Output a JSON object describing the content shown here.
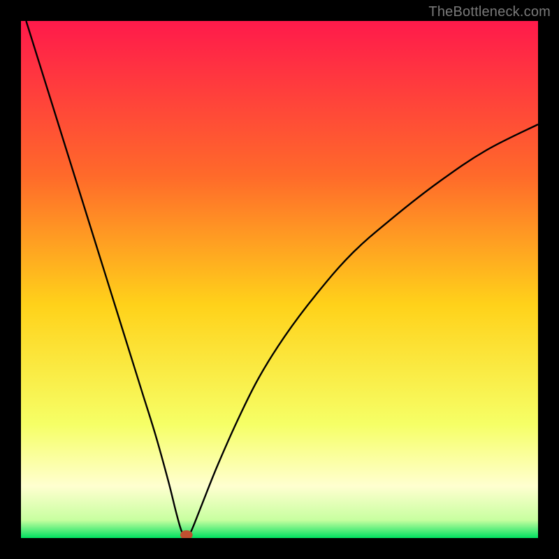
{
  "watermark": "TheBottleneck.com",
  "chart_data": {
    "type": "line",
    "title": "",
    "xlabel": "",
    "ylabel": "",
    "xlim": [
      0,
      100
    ],
    "ylim": [
      0,
      100
    ],
    "grid": false,
    "legend": false,
    "gradient_stops": [
      {
        "offset": 0.0,
        "color": "#ff1a4b"
      },
      {
        "offset": 0.3,
        "color": "#ff6a2a"
      },
      {
        "offset": 0.55,
        "color": "#ffd21a"
      },
      {
        "offset": 0.78,
        "color": "#f6ff66"
      },
      {
        "offset": 0.9,
        "color": "#ffffd0"
      },
      {
        "offset": 0.965,
        "color": "#c8ffa0"
      },
      {
        "offset": 1.0,
        "color": "#00e060"
      }
    ],
    "series": [
      {
        "name": "curve",
        "color": "#000000",
        "x": [
          1,
          3.5,
          6,
          8.5,
          11,
          13.5,
          16,
          18.5,
          21,
          23.5,
          26,
          28.5,
          30,
          31,
          31.7,
          32.3,
          33,
          35,
          38,
          42,
          46,
          51,
          57,
          64,
          72,
          81,
          90,
          100
        ],
        "y": [
          100,
          92,
          84,
          76,
          68,
          60,
          52,
          44,
          36,
          28,
          20,
          11,
          5,
          1.5,
          0.6,
          0.6,
          1.5,
          6.5,
          14,
          23,
          31,
          39,
          47,
          55,
          62,
          69,
          75,
          80
        ]
      }
    ],
    "marker": {
      "x": 32,
      "y": 0.6,
      "rx": 1.2,
      "ry": 0.9,
      "color": "#c05030"
    }
  }
}
